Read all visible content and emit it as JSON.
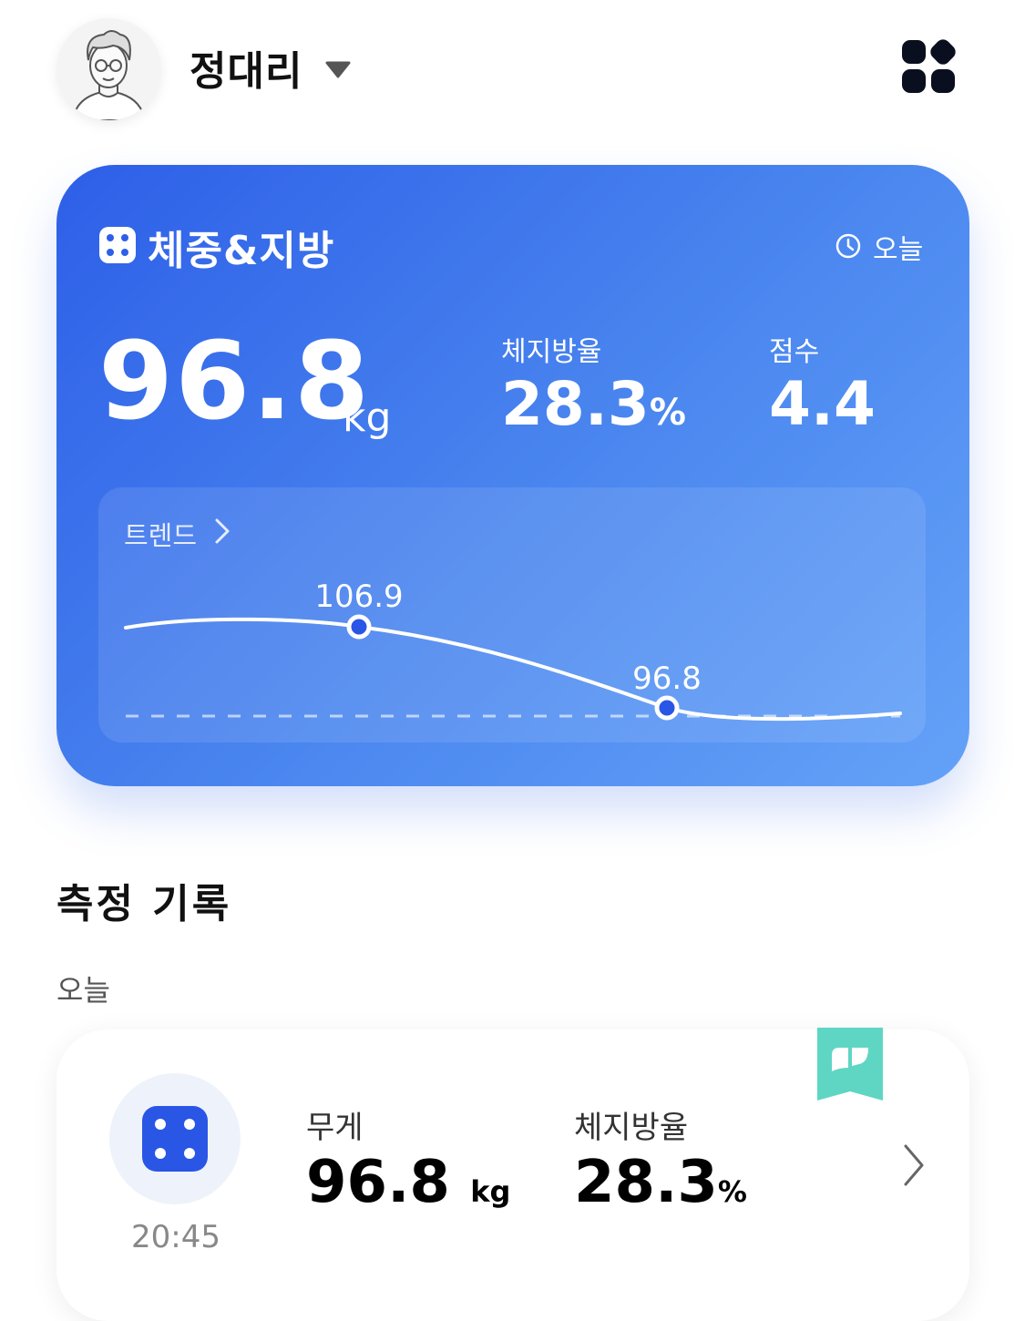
{
  "header": {
    "user_name": "정대리",
    "avatar_icon": "user-avatar-illustration",
    "menu_icon": "apps-grid-icon"
  },
  "summary_card": {
    "title": "체중&지방",
    "date_label": "오늘",
    "weight": {
      "value": "96.8",
      "unit": "kg"
    },
    "body_fat": {
      "label": "체지방율",
      "value": "28.3",
      "unit": "%"
    },
    "score": {
      "label": "점수",
      "value": "4.4"
    },
    "trend": {
      "label": "트렌드",
      "points": [
        {
          "label": "106.9",
          "value": 106.9
        },
        {
          "label": "96.8",
          "value": 96.8
        }
      ]
    },
    "colors": {
      "gradient_start": "#2d5fe8",
      "gradient_end": "#64a2f8",
      "point": "#2a56e6"
    }
  },
  "records": {
    "section_title": "측정 기록",
    "day_label": "오늘",
    "items": [
      {
        "time": "20:45",
        "weight_label": "무게",
        "weight_value": "96.8",
        "weight_unit": "kg",
        "fat_label": "체지방율",
        "fat_value": "28.3",
        "fat_unit": "%",
        "badge_color": "#5fd6c3"
      }
    ]
  }
}
